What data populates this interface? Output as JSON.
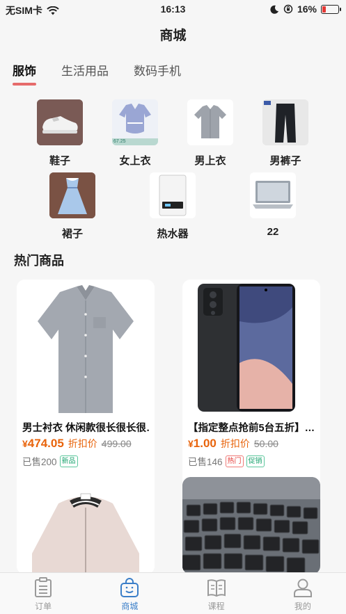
{
  "status_bar": {
    "carrier": "无SIM卡",
    "time": "16:13",
    "battery": "16%",
    "icons": [
      "wifi-icon",
      "moon-icon",
      "orientation-lock-icon",
      "battery-icon"
    ]
  },
  "header": {
    "title": "商城"
  },
  "tabs": [
    {
      "label": "服饰",
      "active": true
    },
    {
      "label": "生活用品",
      "active": false
    },
    {
      "label": "数码手机",
      "active": false
    }
  ],
  "categories_row1": [
    {
      "label": "鞋子",
      "icon": "sneaker-image"
    },
    {
      "label": "女上衣",
      "icon": "blouse-image",
      "thumb_badge": "67.25"
    },
    {
      "label": "男上衣",
      "icon": "mens-shirt-image"
    },
    {
      "label": "男裤子",
      "icon": "mens-trousers-image"
    }
  ],
  "categories_row2": [
    {
      "label": "裙子",
      "icon": "dress-image"
    },
    {
      "label": "热水器",
      "icon": "water-heater-image"
    },
    {
      "label": "22",
      "icon": "laptop-image"
    }
  ],
  "section": {
    "title": "热门商品"
  },
  "products": [
    {
      "name": "男士衬衣 休闲款很长很长很…",
      "currency": "¥",
      "price": "474.05",
      "discount_label": "折扣价",
      "original_price": "499.00",
      "sold": "已售200",
      "badges": [
        "新品"
      ]
    },
    {
      "name": "【指定整点抢前5台五折】…",
      "currency": "¥",
      "price": "1.00",
      "discount_label": "折扣价",
      "original_price": "50.00",
      "sold": "已售146",
      "badges": [
        "热门",
        "促销"
      ]
    }
  ],
  "bottom_tabs": [
    {
      "label": "订单",
      "icon": "order-list-icon",
      "active": false
    },
    {
      "label": "商城",
      "icon": "shopping-bag-icon",
      "active": true
    },
    {
      "label": "课程",
      "icon": "open-book-icon",
      "active": false
    },
    {
      "label": "我的",
      "icon": "user-profile-icon",
      "active": false
    }
  ],
  "colors": {
    "accent_blue": "#3a7ec8",
    "price_orange": "#e8640c",
    "tab_underline": "#e66b6b"
  }
}
